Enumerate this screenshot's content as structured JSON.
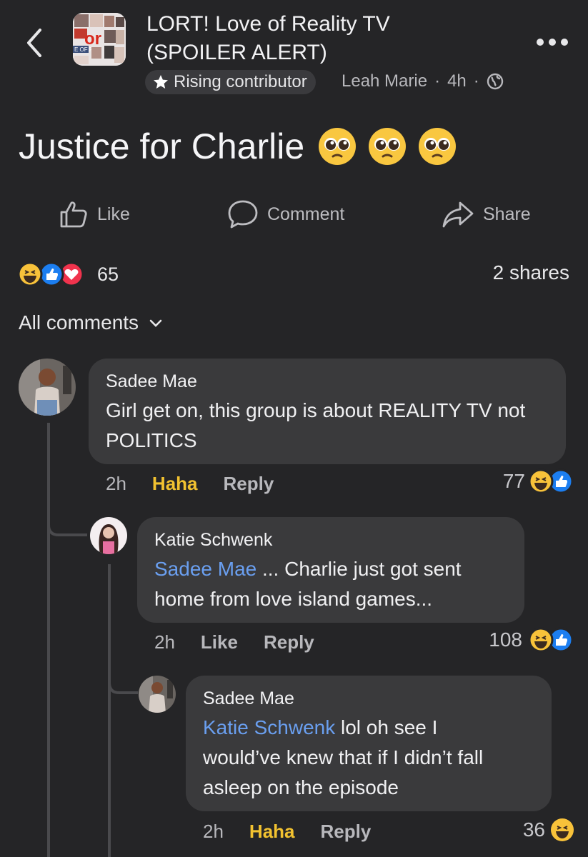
{
  "header": {
    "group_name_line1": "LORT! Love of Reality TV",
    "group_name_line2": "(SPOILER ALERT)",
    "badge": "Rising contributor",
    "author": "Leah Marie",
    "time": "4h"
  },
  "post": {
    "title": "Justice for Charlie",
    "actions": {
      "like": "Like",
      "comment": "Comment",
      "share": "Share"
    },
    "reaction_count": "65",
    "shares": "2 shares"
  },
  "comments_filter": "All comments",
  "comments": [
    {
      "name": "Sadee Mae",
      "text": "Girl get on, this group is about REALITY TV not POLITICS",
      "time": "2h",
      "reaction_label": "Haha",
      "reply": "Reply",
      "count": "77"
    },
    {
      "name": "Katie Schwenk",
      "mention": "Sadee Mae",
      "text_line1": " ... Charlie just got sent",
      "text_line2": "home from love island games...",
      "time": "2h",
      "reaction_label": "Like",
      "reply": "Reply",
      "count": "108"
    },
    {
      "name": "Sadee Mae",
      "mention": "Katie Schwenk",
      "text_line1": " lol oh see I",
      "text_line2": "would’ve knew that if I didn’t fall",
      "text_line3": "asleep on the episode",
      "time": "2h",
      "reaction_label": "Haha",
      "reply": "Reply",
      "count": "36"
    }
  ],
  "colors": {
    "background": "#252527",
    "bubble": "#3a3a3c",
    "mention": "#6a9ff0",
    "haha": "#f2c230"
  }
}
